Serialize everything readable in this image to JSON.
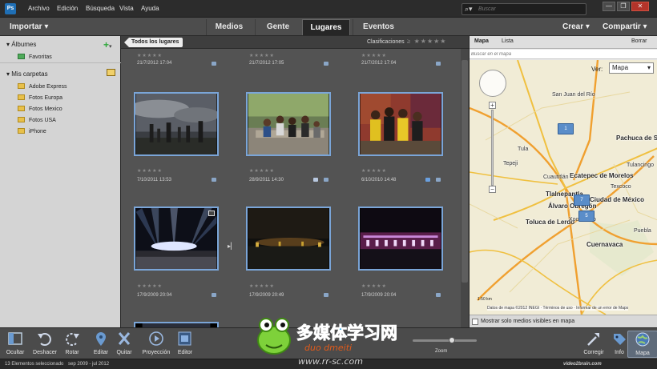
{
  "menubar": {
    "app_icon": "Ps",
    "items": [
      "Archivo",
      "Edición",
      "Búsqueda",
      "Vista",
      "Ayuda"
    ],
    "search_placeholder": "Buscar",
    "window_buttons": [
      "—",
      "❐",
      "✕"
    ]
  },
  "toolbar": {
    "import_label": "Importar ▾",
    "tabs": [
      {
        "label": "Medios",
        "active": false
      },
      {
        "label": "Gente",
        "active": false
      },
      {
        "label": "Lugares",
        "active": true
      },
      {
        "label": "Eventos",
        "active": false
      }
    ],
    "crear_label": "Crear ▾",
    "compartir_label": "Compartir ▾"
  },
  "left_panel": {
    "albums_title": "Álbumes",
    "albums": [
      {
        "label": "Favoritas",
        "icon": "album-icon"
      }
    ],
    "folders_title": "Mis carpetas",
    "folders": [
      "Adobe Express",
      "Fotos Europa",
      "Fotos Mexico",
      "Fotos USA",
      "iPhone"
    ]
  },
  "grid": {
    "breadcrumb": "Todos los lugares",
    "classifications_label": "Clasificaciones",
    "classification_filter": "≥ ★★★★★",
    "top_partial_dates": [
      "21/7/2012 17:04",
      "21/7/2012 17:05",
      "21/7/2012 17:04"
    ],
    "rows": [
      {
        "dates": [
          "7/10/2011 13:53",
          "28/9/2011 14:30",
          "6/10/2010 14:48"
        ],
        "images": [
          "storm-ruins",
          "group-stone-bench",
          "group-mural"
        ]
      },
      {
        "dates": [
          "17/9/2009 20:04",
          "17/9/2009 20:49",
          "17/9/2009 20:04"
        ],
        "images": [
          "stage-lights-crowd",
          "night-plaza",
          "lit-palace"
        ]
      }
    ],
    "star_glyphs": "★★★★★"
  },
  "map_panel": {
    "tabs": [
      "Mapa",
      "Lista"
    ],
    "clear_label": "Borrar",
    "search_placeholder": "Buscar en el mapa",
    "view_label": "Ver:",
    "view_value": "Mapa",
    "markers": [
      {
        "label": "1"
      },
      {
        "label": "7"
      },
      {
        "label": "5"
      }
    ],
    "cities": [
      "San Juan del Río",
      "Pachuca de Soto",
      "Tulancingo",
      "Ecatepec de Morelos",
      "Tlalnepantla",
      "Álvaro Obregón",
      "Ciudad de México",
      "Toluca de Lerdo",
      "Xochimilco",
      "Cuernavaca",
      "Tula",
      "Tepeji",
      "Cuautitlán",
      "Texcoco",
      "Puebla"
    ],
    "scale_label": "1:50 km",
    "copyright": "Datos de mapa ©2012 INEGI · Términos de uso · Informar de un error de Maps",
    "checkbox_label": "Mostrar solo medios visibles en mapa"
  },
  "bottombar": {
    "buttons": [
      {
        "label": "Ocultar",
        "icon": "hide-panel-icon"
      },
      {
        "label": "Deshacer",
        "icon": "undo-icon"
      },
      {
        "label": "Rotar",
        "icon": "rotate-icon"
      },
      {
        "label": "Editar",
        "icon": "place-pin-icon"
      },
      {
        "label": "Quitar",
        "icon": "remove-icon"
      },
      {
        "label": "Proyección",
        "icon": "slideshow-icon"
      },
      {
        "label": "Editor",
        "icon": "editor-icon"
      }
    ],
    "zoom_label": "Zoom",
    "zoom_fraction": 0.62,
    "right_buttons": [
      {
        "label": "Corregir",
        "icon": "fix-icon"
      },
      {
        "label": "Info",
        "icon": "tag-icon"
      },
      {
        "label": "Mapa",
        "icon": "globe-icon"
      }
    ]
  },
  "statusbar": {
    "selected": "13 Elementos seleccionado",
    "range": "sep 2009 - jul 2012",
    "brand": "video2brain.com"
  },
  "watermark": {
    "text_main": "多媒体学习网",
    "text_sub": "www.rr-sc.com",
    "text_en": "duo dmeiti"
  }
}
